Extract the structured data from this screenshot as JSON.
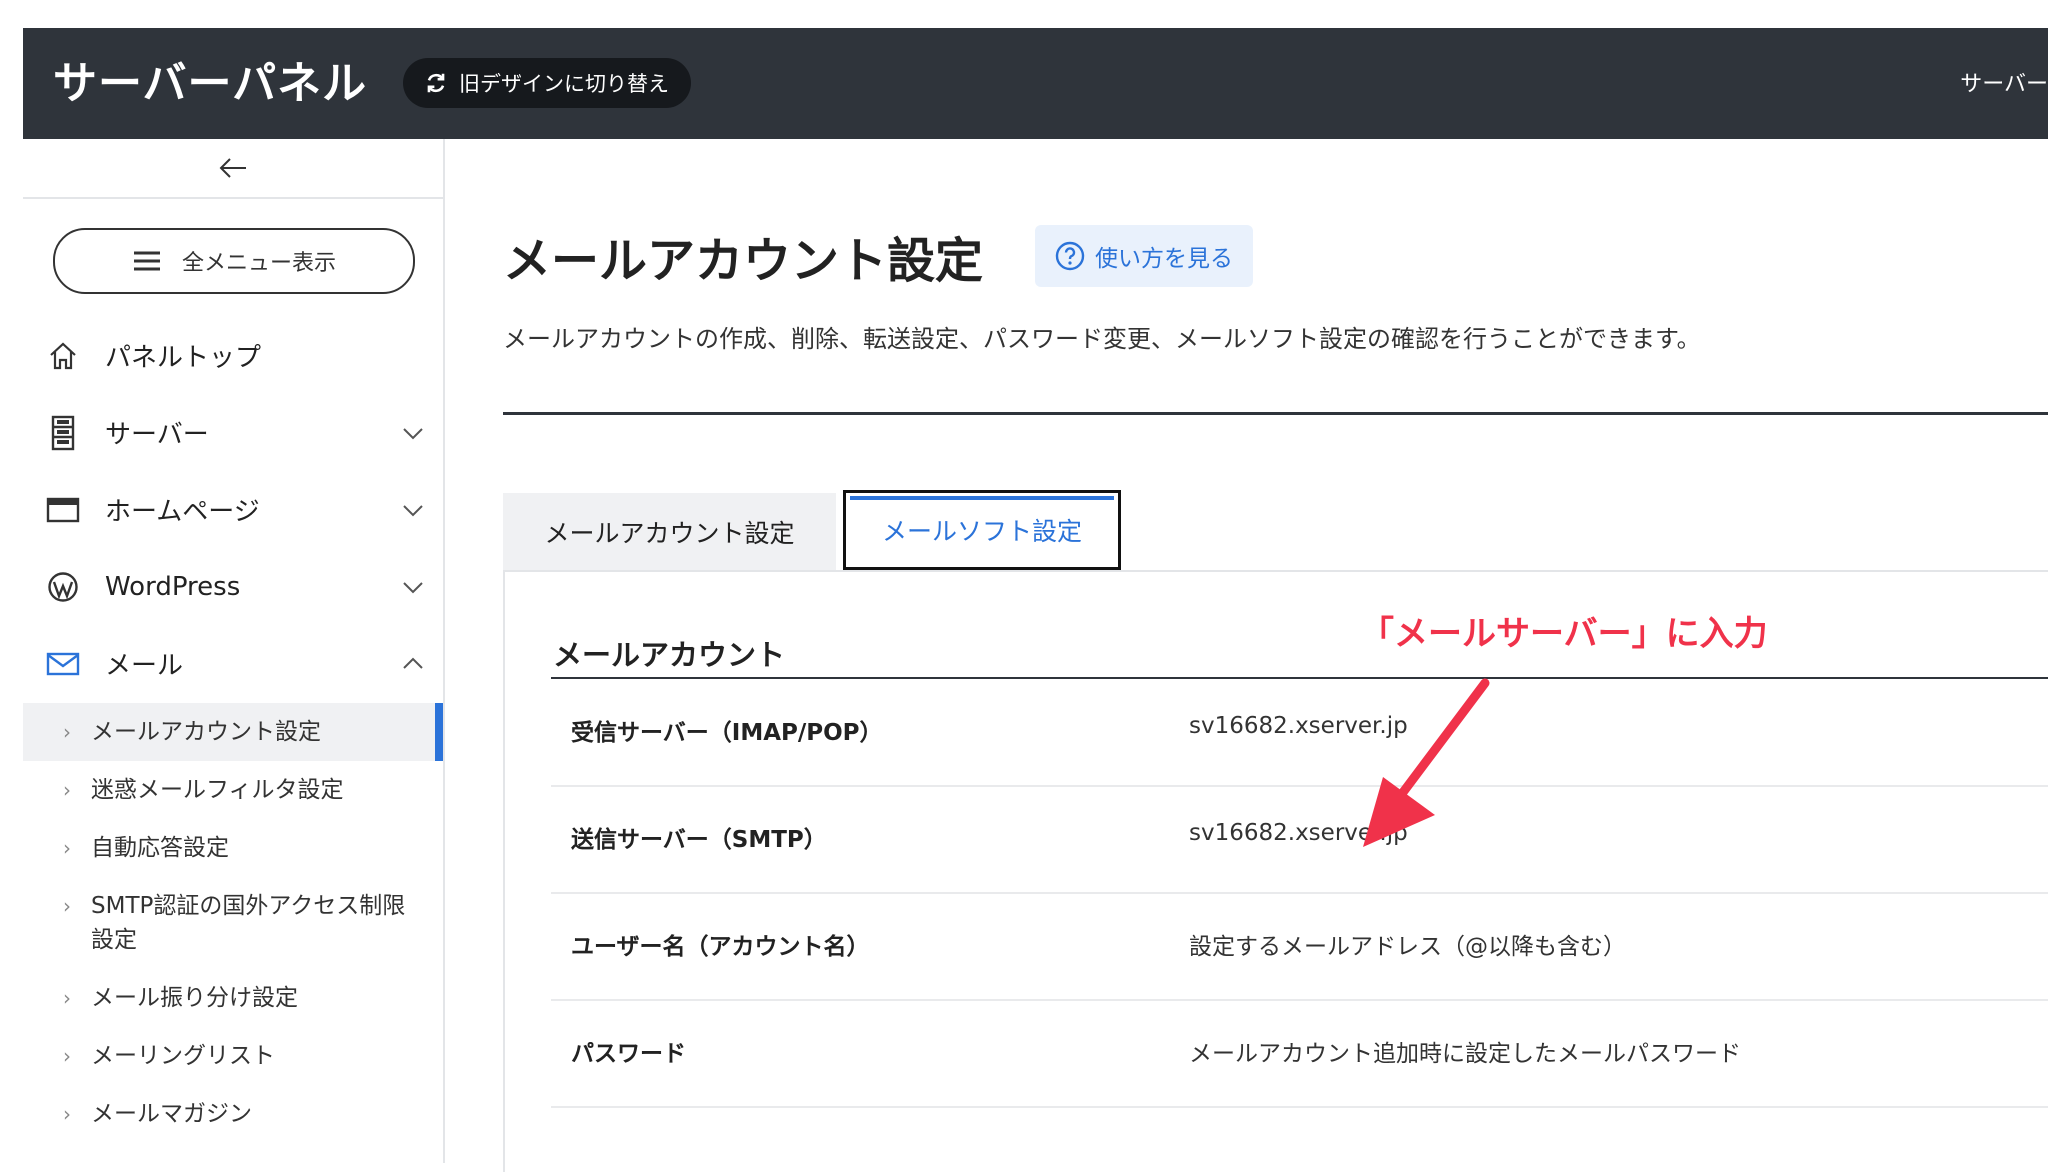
{
  "header": {
    "brand": "サーバーパネル",
    "switch_label": "旧デザインに切り替え",
    "right_text": "サーバー"
  },
  "sidebar": {
    "all_menu": "全メニュー表示",
    "items": [
      {
        "label": "パネルトップ",
        "icon": "home-icon"
      },
      {
        "label": "サーバー",
        "icon": "server-icon"
      },
      {
        "label": "ホームページ",
        "icon": "browser-window-icon"
      },
      {
        "label": "WordPress",
        "icon": "wordpress-icon"
      },
      {
        "label": "メール",
        "icon": "mail-icon"
      }
    ],
    "sub_items": [
      {
        "label": "メールアカウント設定"
      },
      {
        "label": "迷惑メールフィルタ設定"
      },
      {
        "label": "自動応答設定"
      },
      {
        "label": "SMTP認証の国外アクセス制限設定"
      },
      {
        "label": "メール振り分け設定"
      },
      {
        "label": "メーリングリスト"
      },
      {
        "label": "メールマガジン"
      }
    ]
  },
  "main": {
    "title": "メールアカウント設定",
    "howto": "使い方を見る",
    "description": "メールアカウントの作成、削除、転送設定、パスワード変更、メールソフト設定の確認を行うことができます。",
    "tabs": [
      "メールアカウント設定",
      "メールソフト設定"
    ],
    "section_title": "メールアカウント",
    "rows": [
      {
        "key": "受信サーバー（IMAP/POP）",
        "value": "sv16682.xserver.jp"
      },
      {
        "key": "送信サーバー（SMTP）",
        "value": "sv16682.xserver.jp"
      },
      {
        "key": "ユーザー名（アカウント名）",
        "value": "設定するメールアドレス（@以降も含む）"
      },
      {
        "key": "パスワード",
        "value": "メールアカウント追加時に設定したメールパスワード"
      }
    ]
  },
  "annotation": {
    "text": "「メールサーバー」に入力",
    "color": "#f0324a"
  },
  "colors": {
    "accent": "#2b73d9",
    "header_bg": "#2f343b"
  }
}
